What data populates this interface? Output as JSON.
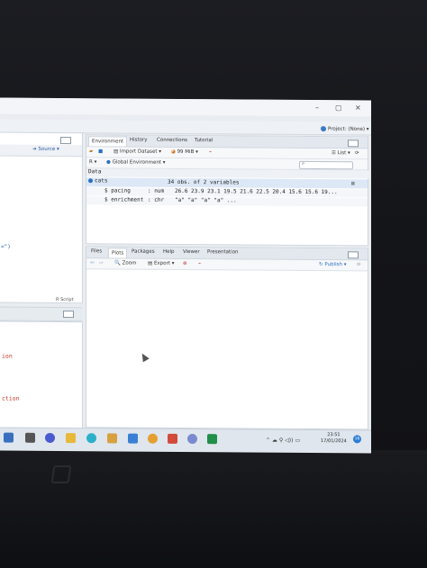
{
  "project": {
    "label": "Project: (None)"
  },
  "source_pane": {
    "source_button": "Source",
    "code_fragment": "=\")",
    "rscript_label": "R Script"
  },
  "console": {
    "lines": [
      "ion",
      "ction"
    ]
  },
  "env_pane": {
    "tabs": [
      "Environment",
      "History",
      "Connections",
      "Tutorial"
    ],
    "import_dataset": "Import Dataset",
    "memory": "99 MiB",
    "list_view": "List",
    "r_label": "R",
    "global_env": "Global Environment",
    "section_header": "Data",
    "object_name": "cats",
    "object_summary": "34 obs. of 2 variables",
    "variables": [
      {
        "name": "$ pacing    ",
        "type": ": num",
        "values": "26.6 23.9 23.1 19.5 21.6 22.5 20.4 15.6 15.6 19..."
      },
      {
        "name": "$ enrichment",
        "type": ": chr",
        "values": "\"a\" \"a\" \"a\" \"a\" ..."
      }
    ]
  },
  "files_pane": {
    "tabs": [
      "Files",
      "Plots",
      "Packages",
      "Help",
      "Viewer",
      "Presentation"
    ],
    "zoom": "Zoom",
    "export": "Export",
    "publish": "Publish"
  },
  "taskbar": {
    "time": "23:51",
    "date": "17/01/2024",
    "notifications": "16"
  },
  "colors": {
    "accent": "#2b6fc7",
    "bezel": "#15161a",
    "screen_bg": "#e9edf1"
  }
}
